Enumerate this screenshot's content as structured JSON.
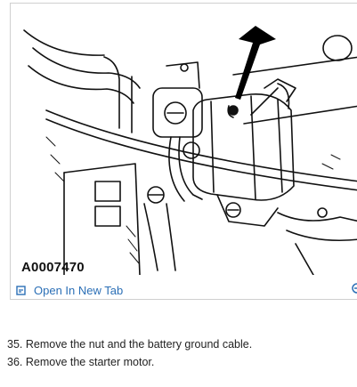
{
  "figure": {
    "id": "A0007470",
    "open_link_label": "Open In New Tab",
    "icons": [
      "open-new-tab-icon",
      "expand-icon"
    ]
  },
  "steps": [
    "35. Remove the nut and the battery ground cable.",
    "36. Remove the starter motor."
  ]
}
